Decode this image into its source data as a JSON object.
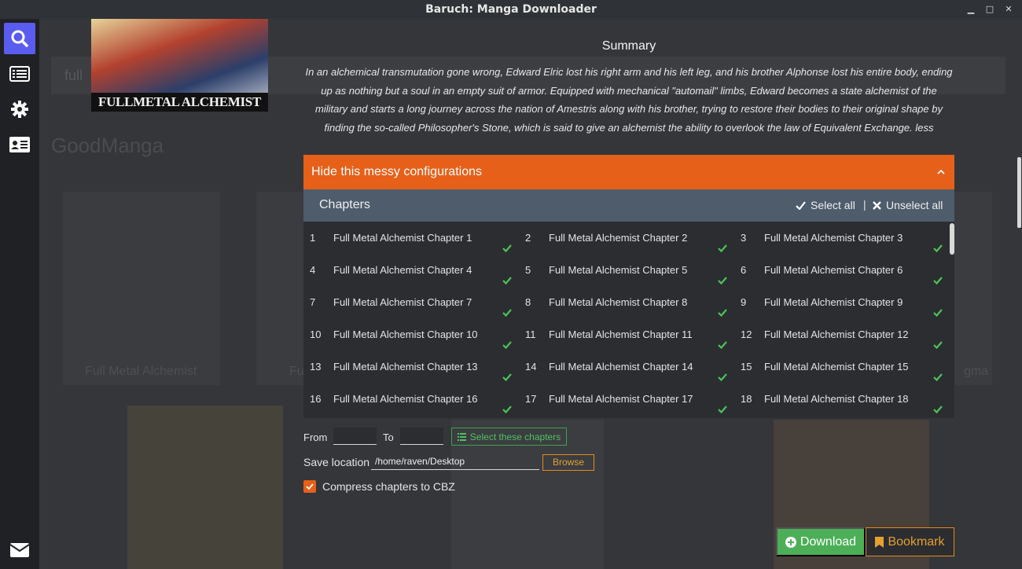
{
  "window": {
    "title": "Baruch: Manga Downloader",
    "controls": {
      "minimize": "▁",
      "maximize": "□",
      "close": "✕"
    }
  },
  "sidebar": {
    "items": [
      {
        "icon": "search-icon",
        "active": true
      },
      {
        "icon": "list-icon",
        "active": false
      },
      {
        "icon": "gear-icon",
        "active": false
      },
      {
        "icon": "profile-card-icon",
        "active": false
      }
    ],
    "bottom_icon": "mail-icon"
  },
  "background": {
    "search_value": "full",
    "source_name": "GoodManga",
    "cards": [
      {
        "title": "Full Metal Alchemist"
      },
      {
        "title": "Fu"
      },
      {
        "title": "gma"
      }
    ]
  },
  "manga": {
    "cover_title": "FULLMETAL ALCHEMIST",
    "summary_heading": "Summary",
    "summary": "In an alchemical transmutation gone wrong, Edward Elric lost his right arm and his left leg, and his brother Alphonse lost his entire body, ending up as nothing but a soul in an empty suit of armor. Equipped with mechanical \"automail\" limbs, Edward becomes a state alchemist of the military and starts a long journey across the nation of Amestris along with his brother, trying to restore their bodies to their original shape by finding the so-called Philosopher's Stone, which is said to give an alchemist the ability to overlook the law of Equivalent Exchange. less"
  },
  "config": {
    "toggle_label": "Hide this messy configurations",
    "chapters_heading": "Chapters",
    "select_all": "Select all",
    "separator": "|",
    "unselect_all": "Unselect all",
    "chapters": [
      {
        "num": "1",
        "name": "Full Metal Alchemist Chapter 1"
      },
      {
        "num": "2",
        "name": "Full Metal Alchemist Chapter 2"
      },
      {
        "num": "3",
        "name": "Full Metal Alchemist Chapter 3"
      },
      {
        "num": "4",
        "name": "Full Metal Alchemist Chapter 4"
      },
      {
        "num": "5",
        "name": "Full Metal Alchemist Chapter 5"
      },
      {
        "num": "6",
        "name": "Full Metal Alchemist Chapter 6"
      },
      {
        "num": "7",
        "name": "Full Metal Alchemist Chapter 7"
      },
      {
        "num": "8",
        "name": "Full Metal Alchemist Chapter 8"
      },
      {
        "num": "9",
        "name": "Full Metal Alchemist Chapter 9"
      },
      {
        "num": "10",
        "name": "Full Metal Alchemist Chapter 10"
      },
      {
        "num": "11",
        "name": "Full Metal Alchemist Chapter 11"
      },
      {
        "num": "12",
        "name": "Full Metal Alchemist Chapter 12"
      },
      {
        "num": "13",
        "name": "Full Metal Alchemist Chapter 13"
      },
      {
        "num": "14",
        "name": "Full Metal Alchemist Chapter 14"
      },
      {
        "num": "15",
        "name": "Full Metal Alchemist Chapter 15"
      },
      {
        "num": "16",
        "name": "Full Metal Alchemist Chapter 16"
      },
      {
        "num": "17",
        "name": "Full Metal Alchemist Chapter 17"
      },
      {
        "num": "18",
        "name": "Full Metal Alchemist Chapter 18"
      }
    ],
    "from_label": "From",
    "to_label": "To",
    "from_value": "",
    "to_value": "",
    "select_range_label": "Select these chapters",
    "save_location_label": "Save location",
    "save_location_value": "/home/raven/Desktop",
    "browse_label": "Browse",
    "compress_label": "Compress chapters to CBZ",
    "compress_checked": true
  },
  "actions": {
    "download_label": "Download",
    "bookmark_label": "Bookmark"
  },
  "colors": {
    "accent_orange": "#e6601a",
    "success_green": "#4caf58",
    "active_sidebar": "#5a5cf0",
    "check_green": "#4dc25e"
  }
}
